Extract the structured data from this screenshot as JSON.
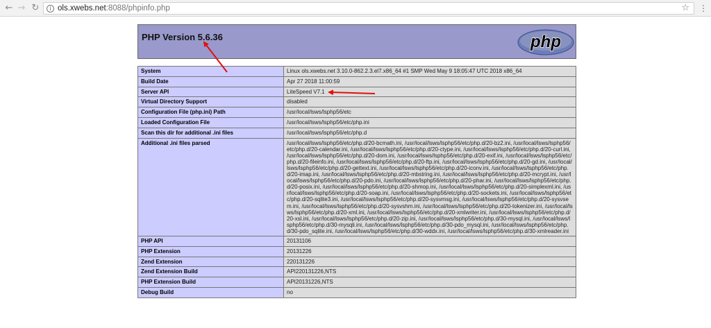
{
  "browser": {
    "url_host": "ols.xwebs.net",
    "url_rest": ":8088/phpinfo.php"
  },
  "header": {
    "title": "PHP Version 5.6.36",
    "logo_text": "php"
  },
  "rows": [
    {
      "label": "System",
      "value": "Linux ols.xwebs.net 3.10.0-862.2.3.el7.x86_64 #1 SMP Wed May 9 18:05:47 UTC 2018 x86_64"
    },
    {
      "label": "Build Date",
      "value": "Apr 27 2018 11:00:59"
    },
    {
      "label": "Server API",
      "value": "LiteSpeed V7.1"
    },
    {
      "label": "Virtual Directory Support",
      "value": "disabled"
    },
    {
      "label": "Configuration File (php.ini) Path",
      "value": "/usr/local/lsws/lsphp56/etc"
    },
    {
      "label": "Loaded Configuration File",
      "value": "/usr/local/lsws/lsphp56/etc/php.ini"
    },
    {
      "label": "Scan this dir for additional .ini files",
      "value": "/usr/local/lsws/lsphp56/etc/php.d"
    },
    {
      "label": "Additional .ini files parsed",
      "value": "/usr/local/lsws/lsphp56/etc/php.d/20-bcmath.ini, /usr/local/lsws/lsphp56/etc/php.d/20-bz2.ini, /usr/local/lsws/lsphp56/etc/php.d/20-calendar.ini, /usr/local/lsws/lsphp56/etc/php.d/20-ctype.ini, /usr/local/lsws/lsphp56/etc/php.d/20-curl.ini, /usr/local/lsws/lsphp56/etc/php.d/20-dom.ini, /usr/local/lsws/lsphp56/etc/php.d/20-exif.ini, /usr/local/lsws/lsphp56/etc/php.d/20-fileinfo.ini, /usr/local/lsws/lsphp56/etc/php.d/20-ftp.ini, /usr/local/lsws/lsphp56/etc/php.d/20-gd.ini, /usr/local/lsws/lsphp56/etc/php.d/20-gettext.ini, /usr/local/lsws/lsphp56/etc/php.d/20-iconv.ini, /usr/local/lsws/lsphp56/etc/php.d/20-imap.ini, /usr/local/lsws/lsphp56/etc/php.d/20-mbstring.ini, /usr/local/lsws/lsphp56/etc/php.d/20-mcrypt.ini, /usr/local/lsws/lsphp56/etc/php.d/20-pdo.ini, /usr/local/lsws/lsphp56/etc/php.d/20-phar.ini, /usr/local/lsws/lsphp56/etc/php.d/20-posix.ini, /usr/local/lsws/lsphp56/etc/php.d/20-shmop.ini, /usr/local/lsws/lsphp56/etc/php.d/20-simplexml.ini, /usr/local/lsws/lsphp56/etc/php.d/20-soap.ini, /usr/local/lsws/lsphp56/etc/php.d/20-sockets.ini, /usr/local/lsws/lsphp56/etc/php.d/20-sqlite3.ini, /usr/local/lsws/lsphp56/etc/php.d/20-sysvmsg.ini, /usr/local/lsws/lsphp56/etc/php.d/20-sysvsem.ini, /usr/local/lsws/lsphp56/etc/php.d/20-sysvshm.ini, /usr/local/lsws/lsphp56/etc/php.d/20-tokenizer.ini, /usr/local/lsws/lsphp56/etc/php.d/20-xml.ini, /usr/local/lsws/lsphp56/etc/php.d/20-xmlwriter.ini, /usr/local/lsws/lsphp56/etc/php.d/20-xsl.ini, /usr/local/lsws/lsphp56/etc/php.d/20-zip.ini, /usr/local/lsws/lsphp56/etc/php.d/30-mysql.ini, /usr/local/lsws/lsphp56/etc/php.d/30-mysqli.ini, /usr/local/lsws/lsphp56/etc/php.d/30-pdo_mysql.ini, /usr/local/lsws/lsphp56/etc/php.d/30-pdo_sqlite.ini, /usr/local/lsws/lsphp56/etc/php.d/30-wddx.ini, /usr/local/lsws/lsphp56/etc/php.d/30-xmlreader.ini"
    },
    {
      "label": "PHP API",
      "value": "20131106"
    },
    {
      "label": "PHP Extension",
      "value": "20131226"
    },
    {
      "label": "Zend Extension",
      "value": "220131226"
    },
    {
      "label": "Zend Extension Build",
      "value": "API220131226,NTS"
    },
    {
      "label": "PHP Extension Build",
      "value": "API20131226,NTS"
    },
    {
      "label": "Debug Build",
      "value": "no"
    }
  ],
  "colors": {
    "header_bg": "#9999cc",
    "label_bg": "#ccccff",
    "value_bg": "#dddddd",
    "arrow": "#e01010"
  }
}
